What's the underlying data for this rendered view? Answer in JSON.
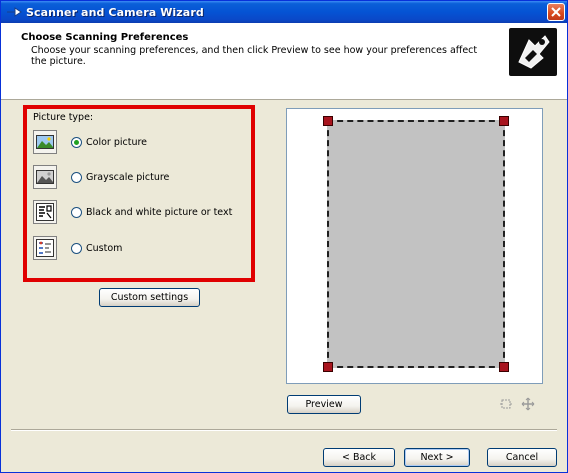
{
  "window": {
    "title": "Scanner and Camera Wizard"
  },
  "header": {
    "title": "Choose Scanning Preferences",
    "description": "Choose your scanning preferences, and then click Preview to see how your preferences affect the picture."
  },
  "picture_type": {
    "label": "Picture type:",
    "options": [
      {
        "label": "Color picture",
        "selected": true,
        "icon": "color-picture-icon"
      },
      {
        "label": "Grayscale picture",
        "selected": false,
        "icon": "grayscale-picture-icon"
      },
      {
        "label": "Black and white picture or text",
        "selected": false,
        "icon": "black-white-picture-icon"
      },
      {
        "label": "Custom",
        "selected": false,
        "icon": "custom-icon"
      }
    ]
  },
  "buttons": {
    "custom_settings": "Custom settings",
    "preview": "Preview",
    "back": "< Back",
    "next": "Next >",
    "cancel": "Cancel"
  },
  "colors": {
    "highlight_border": "#e00000",
    "title_bar": "#0553d4",
    "scan_area": "#c2c2c2",
    "crop_handle": "#a8141e"
  }
}
